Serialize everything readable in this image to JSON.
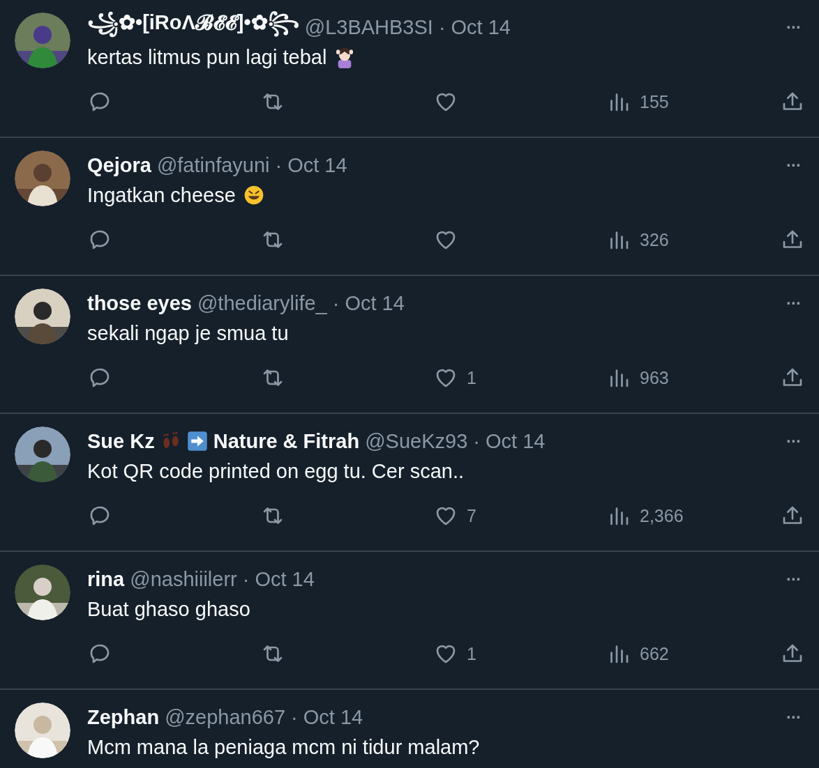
{
  "tweets": [
    {
      "name": [
        {
          "kind": "text",
          "text": "꧁✿•[iRoΛ𝓑𝓔𝓔]•✿꧂"
        }
      ],
      "handle": "@L3BAHB3SI",
      "separator": "·",
      "date": "Oct 14",
      "text": "kertas litmus pun lagi tebal",
      "trailing": [
        {
          "kind": "person"
        }
      ],
      "more": "···",
      "views": "155"
    },
    {
      "name": [
        {
          "kind": "text",
          "text": "Qejora"
        }
      ],
      "handle": "@fatinfayuni",
      "separator": "·",
      "date": "Oct 14",
      "text": "Ingatkan cheese",
      "trailing": [
        {
          "kind": "laugh"
        }
      ],
      "more": "···",
      "views": "326"
    },
    {
      "name": [
        {
          "kind": "text",
          "text": "those eyes"
        }
      ],
      "handle": "@thediarylife_",
      "separator": "·",
      "date": "Oct 14",
      "text": "sekali ngap je smua tu",
      "more": "···",
      "likes": "1",
      "views": "963"
    },
    {
      "name": [
        {
          "kind": "text",
          "text": "Sue Kz"
        },
        {
          "kind": "feet"
        },
        {
          "kind": "arrow"
        },
        {
          "kind": "text",
          "text": "Nature & Fitrah"
        }
      ],
      "handle": "@SueKz93",
      "separator": "·",
      "date": "Oct 14",
      "text": "Kot QR code printed on egg tu. Cer scan..",
      "more": "···",
      "likes": "7",
      "views": "2,366"
    },
    {
      "name": [
        {
          "kind": "text",
          "text": "rina"
        }
      ],
      "handle": "@nashiiilerr",
      "separator": "·",
      "date": "Oct 14",
      "text": "Buat ghaso ghaso",
      "more": "···",
      "likes": "1",
      "views": "662"
    },
    {
      "name": [
        {
          "kind": "text",
          "text": "Zephan"
        }
      ],
      "handle": "@zephan667",
      "separator": "·",
      "date": "Oct 14",
      "text": "Mcm mana la peniaga mcm ni tidur malam?",
      "more": "···"
    }
  ]
}
